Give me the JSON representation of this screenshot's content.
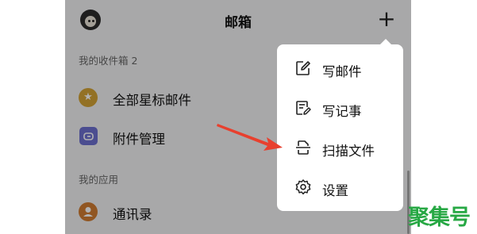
{
  "header": {
    "title": "邮箱",
    "add_label": "+"
  },
  "sections": {
    "inbox_label": "我的收件箱 2",
    "apps_label": "我的应用"
  },
  "rows": {
    "starred": "全部星标邮件",
    "attachments": "附件管理",
    "contacts": "通讯录"
  },
  "menu": {
    "items": [
      {
        "label": "写邮件",
        "icon": "compose-icon"
      },
      {
        "label": "写记事",
        "icon": "note-icon"
      },
      {
        "label": "扫描文件",
        "icon": "scan-icon"
      },
      {
        "label": "设置",
        "icon": "gear-icon"
      }
    ]
  },
  "annotation": {
    "arrow_color": "#e8402e"
  },
  "watermark": {
    "text": "聚集号"
  }
}
